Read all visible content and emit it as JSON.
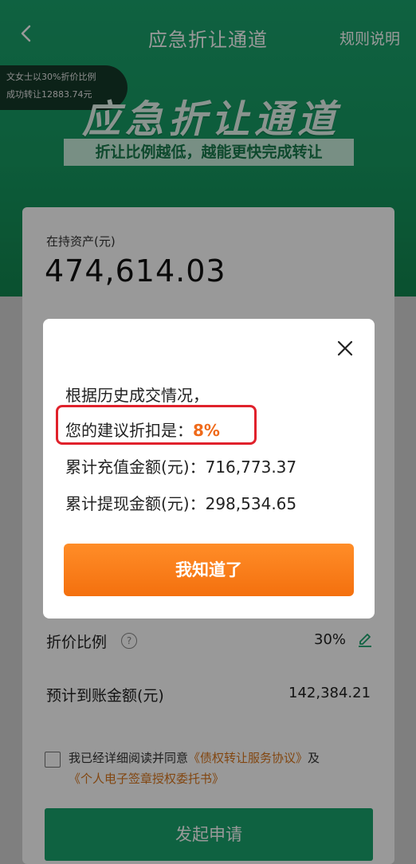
{
  "nav": {
    "title": "应急折让通道",
    "rules_label": "规则说明"
  },
  "ticker": {
    "line1": "文女士以30%折价比例",
    "line2": "成功转让12883.74元"
  },
  "banner": {
    "title": "应急折让通道",
    "subtitle": "折让比例越低，越能更快完成转让"
  },
  "asset": {
    "label": "在持资产(元)",
    "value": "474,614.03"
  },
  "discount": {
    "label": "折价比例",
    "value": "30%"
  },
  "expected": {
    "label": "预计到账金额(元)",
    "value": "142,384.21"
  },
  "agreement": {
    "prefix": "我已经详细阅读并同意",
    "link1": "《债权转让服务协议》",
    "conj": "及",
    "link2": "《个人电子签章授权委托书》"
  },
  "submit_label": "发起申请",
  "dialog": {
    "line1": "根据历史成交情况，",
    "suggest_label": "您的建议折扣是：",
    "suggest_value": "8%",
    "recharge_label": "累计充值金额(元)：",
    "recharge_value": "716,773.37",
    "withdraw_label": "累计提现金额(元)：",
    "withdraw_value": "298,534.65",
    "ok_label": "我知道了"
  },
  "colors": {
    "brand_green": "#1aa36d",
    "accent_orange": "#ef6a1a",
    "highlight_red": "#e0212b"
  },
  "icons": [
    "back-icon",
    "help-icon",
    "edit-icon",
    "close-icon",
    "checkbox"
  ]
}
